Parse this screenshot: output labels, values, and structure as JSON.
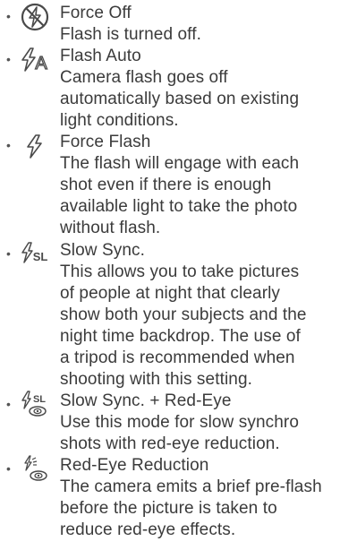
{
  "bullet": "•",
  "items": [
    {
      "icon": "flash-off-icon",
      "title": "Force Off",
      "lines": [
        "Flash is turned off."
      ]
    },
    {
      "icon": "flash-auto-icon",
      "title": "Flash Auto",
      "lines": [
        "Camera flash goes off",
        "automatically based on existing",
        "light conditions."
      ]
    },
    {
      "icon": "force-flash-icon",
      "title": "Force Flash",
      "lines": [
        "The flash will engage with each",
        "shot even if there is enough",
        "available light to take the photo",
        "without flash."
      ]
    },
    {
      "icon": "slow-sync-icon",
      "title": "Slow Sync.",
      "lines": [
        "This allows you to take pictures",
        "of people at night that clearly",
        "show both your subjects and the",
        "night time backdrop. The use of",
        "a tripod is recommended when",
        "shooting with this setting."
      ]
    },
    {
      "icon": "slow-sync-red-eye-icon",
      "title": "Slow Sync. + Red-Eye",
      "lines": [
        "Use this mode for slow synchro",
        "shots with red-eye reduction."
      ]
    },
    {
      "icon": "red-eye-reduction-icon",
      "title": "Red-Eye Reduction",
      "lines": [
        "The camera emits a brief pre-flash",
        "before the picture is taken to",
        "reduce red-eye effects."
      ]
    }
  ],
  "icon_label_sl": "SL",
  "icon_label_a": "A"
}
